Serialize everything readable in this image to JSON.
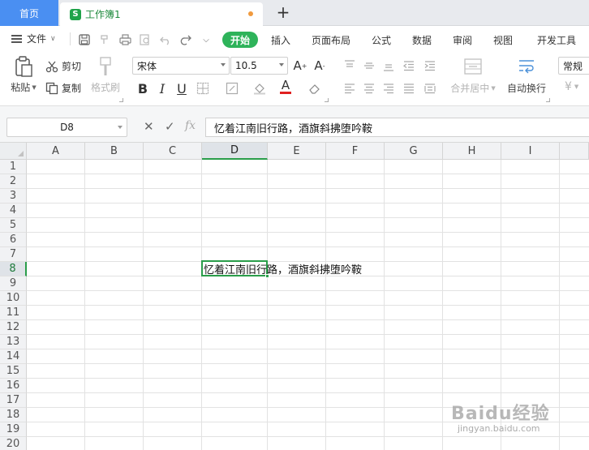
{
  "tabs": {
    "home": "首页",
    "document": "工作簿1",
    "document_badge": "S",
    "add": "+"
  },
  "menu": {
    "file": "文件",
    "items": [
      "开始",
      "插入",
      "页面布局",
      "公式",
      "数据",
      "审阅",
      "视图",
      "开发工具"
    ],
    "active_index": 0
  },
  "ribbon": {
    "paste": "粘贴",
    "cut": "剪切",
    "copy": "复制",
    "format_painter": "格式刷",
    "font_name": "宋体",
    "font_size": "10.5",
    "merge_center": "合并居中",
    "wrap_text": "自动换行",
    "number_format": "常规",
    "currency": "¥"
  },
  "formula_bar": {
    "name_box": "D8",
    "fx": "fx",
    "value": "忆着江南旧行路，酒旗斜拂堕吟鞍"
  },
  "sheet": {
    "columns": [
      "A",
      "B",
      "C",
      "D",
      "E",
      "F",
      "G",
      "H",
      "I"
    ],
    "rows": [
      "1",
      "2",
      "3",
      "4",
      "5",
      "6",
      "7",
      "8",
      "9",
      "10",
      "11",
      "12",
      "13",
      "14",
      "15",
      "16",
      "17",
      "18",
      "19",
      "20"
    ],
    "active_cell": "D8",
    "cell_D8": "忆着江南旧行路，酒旗斜拂堕吟鞍"
  },
  "watermark": {
    "main": "Baidu经验",
    "sub": "jingyan.baidu.com"
  },
  "colors": {
    "accent_green": "#2eb35a",
    "home_tab_blue": "#4a8ff2",
    "selection_green": "#2a9d4a"
  }
}
